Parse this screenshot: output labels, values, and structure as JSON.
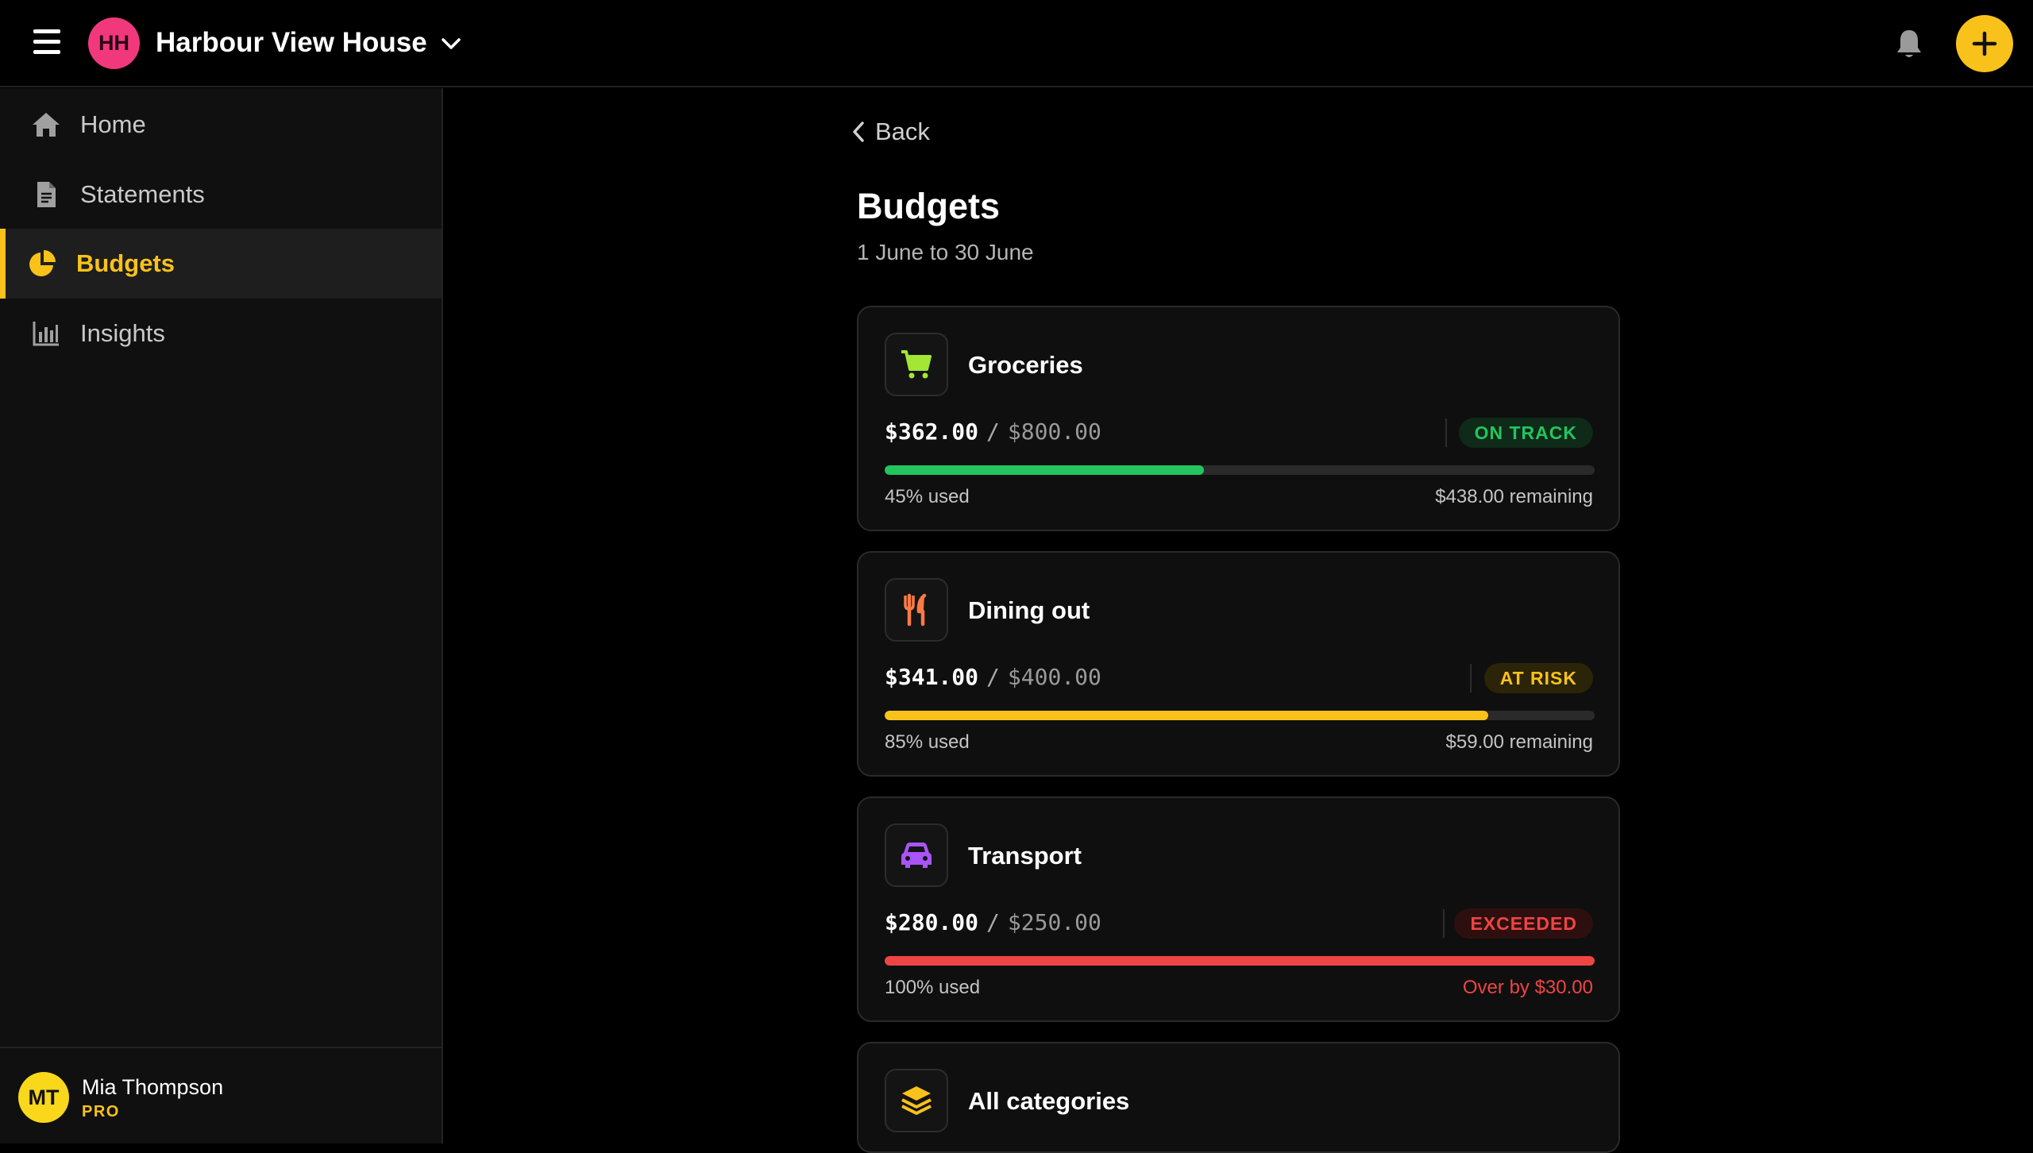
{
  "header": {
    "menu_icon": "hamburger-icon",
    "house_initials": "HH",
    "house_name": "Harbour View House",
    "bell_icon": "bell-icon",
    "add_icon": "plus-icon"
  },
  "sidebar": {
    "items": [
      {
        "label": "Home",
        "icon": "home-icon",
        "active": false
      },
      {
        "label": "Statements",
        "icon": "document-icon",
        "active": false
      },
      {
        "label": "Budgets",
        "icon": "pie-chart-icon",
        "active": true
      },
      {
        "label": "Insights",
        "icon": "bar-chart-icon",
        "active": false
      }
    ],
    "user": {
      "initials": "MT",
      "name": "Mia Thompson",
      "plan": "PRO"
    }
  },
  "main": {
    "back_label": "Back",
    "title": "Budgets",
    "period": "1 June to 30 June",
    "budgets": [
      {
        "name": "Groceries",
        "icon": "shopping-cart-icon",
        "icon_color": "#a3e635",
        "spent": "$362.00",
        "separator": "/",
        "limit": "$800.00",
        "status": "ON TRACK",
        "status_color": "#22c55e",
        "status_bg": "#0f2a18",
        "progress_fraction": 0.45,
        "bar_color": "#22c55e",
        "used_text": "45% used",
        "right_text": "$438.00 remaining",
        "right_color": "#c4c4c4"
      },
      {
        "name": "Dining out",
        "icon": "fork-knife-icon",
        "icon_color": "#fb7b45",
        "spent": "$341.00",
        "separator": "/",
        "limit": "$400.00",
        "status": "AT RISK",
        "status_color": "#f9c21b",
        "status_bg": "#2b2408",
        "progress_fraction": 0.85,
        "bar_color": "#f9c21b",
        "used_text": "85% used",
        "right_text": "$59.00 remaining",
        "right_color": "#c4c4c4"
      },
      {
        "name": "Transport",
        "icon": "car-icon",
        "icon_color": "#a855f7",
        "spent": "$280.00",
        "separator": "/",
        "limit": "$250.00",
        "status": "EXCEEDED",
        "status_color": "#ef4444",
        "status_bg": "#2e0f0f",
        "progress_fraction": 1.0,
        "bar_color": "#ef4444",
        "used_text": "100% used",
        "right_text": "Over by $30.00",
        "right_color": "#ef4444"
      }
    ],
    "all_categories": {
      "name": "All categories",
      "icon": "layers-icon",
      "icon_color": "#f9c21b"
    }
  }
}
